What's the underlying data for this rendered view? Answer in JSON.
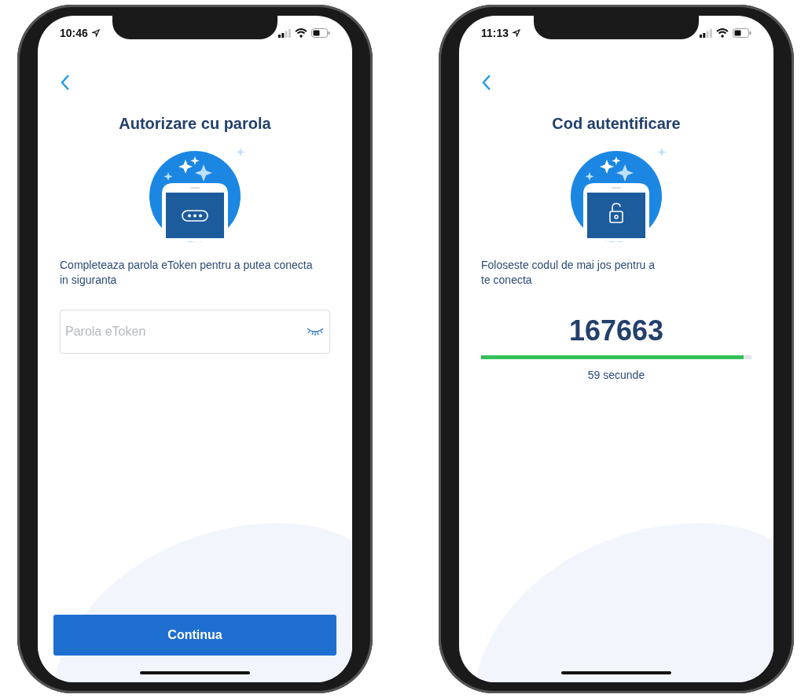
{
  "phones": [
    {
      "kind": "password",
      "time": "10:46",
      "title": "Autorizare cu parola",
      "instruction": "Completeaza parola eToken pentru a putea conecta in siguranta",
      "field": {
        "placeholder": "Parola eToken"
      },
      "button": "Continua"
    },
    {
      "kind": "code",
      "time": "11:13",
      "title": "Cod autentificare",
      "instruction": "Foloseste codul de mai jos pentru a te conecta",
      "code": "167663",
      "timer": {
        "level": 0.97,
        "reading": "59 secunde"
      }
    }
  ]
}
